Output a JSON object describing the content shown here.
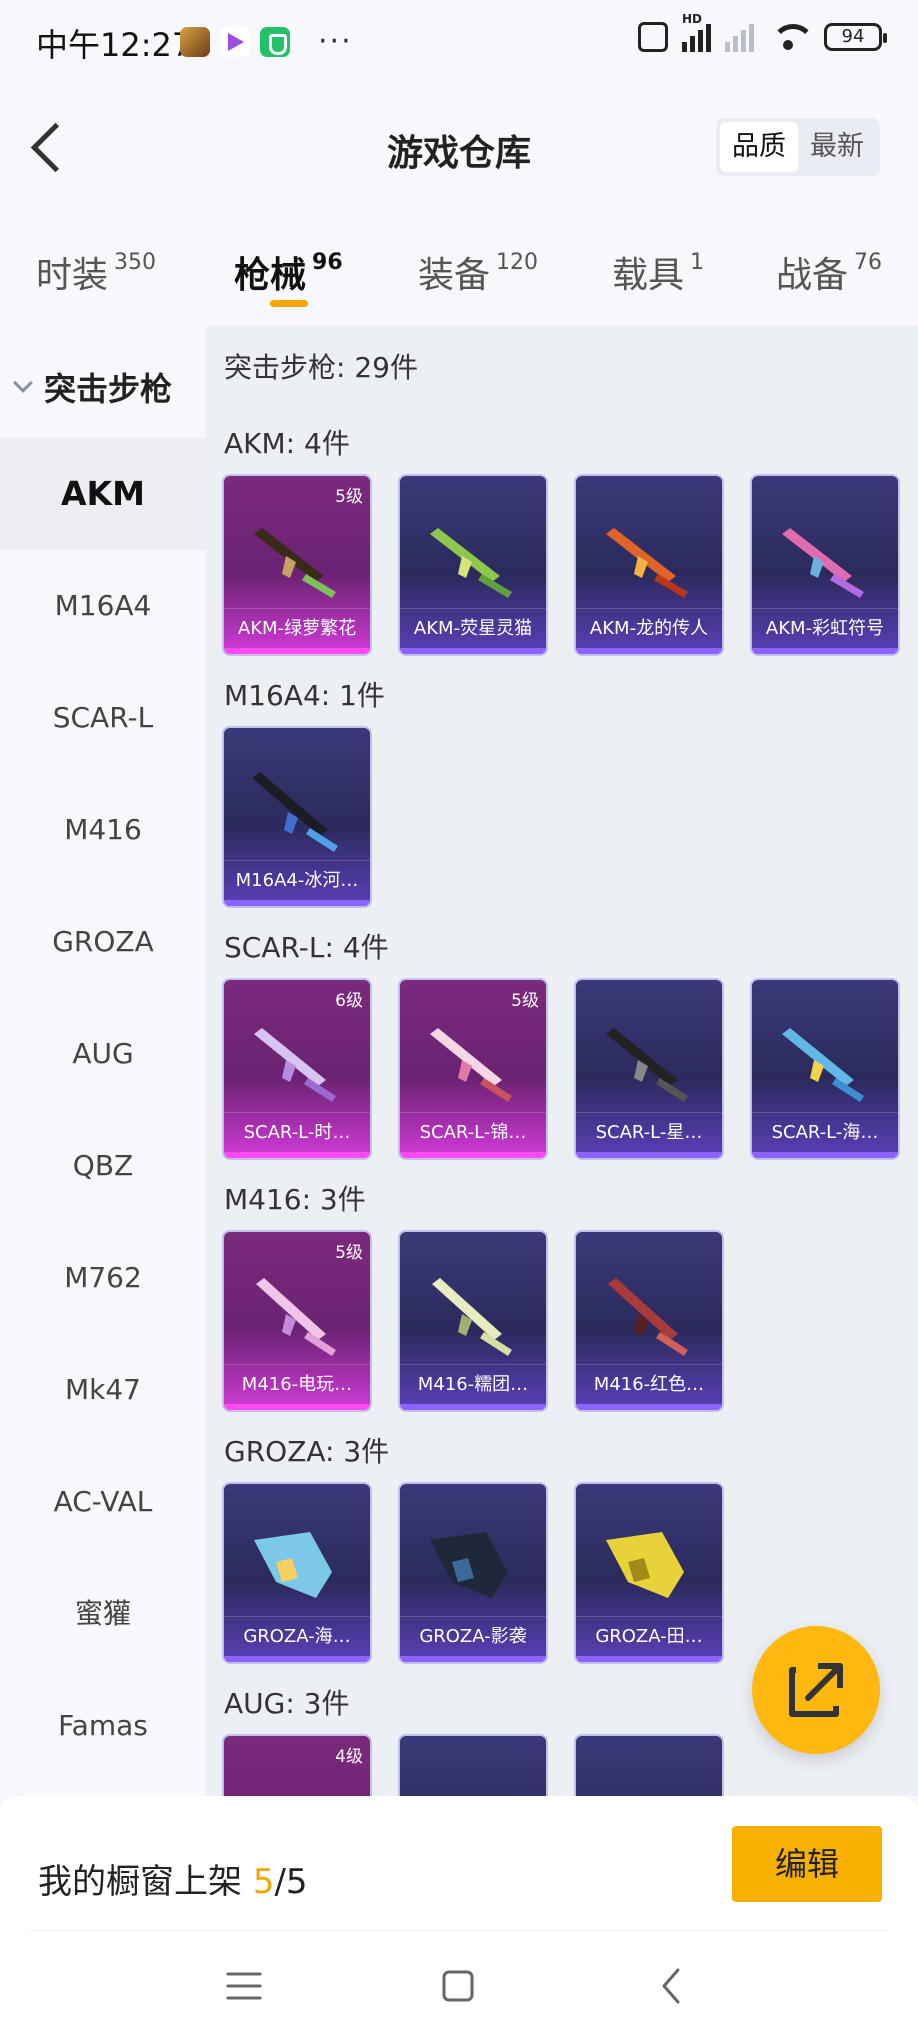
{
  "status_bar": {
    "time": "中午12:27",
    "more": "···",
    "hd_label": "HD",
    "battery": "94"
  },
  "header": {
    "title": "游戏仓库",
    "sort_options": [
      "品质",
      "最新"
    ],
    "sort_selected": "品质"
  },
  "tabs": [
    {
      "label": "时装",
      "count": "350"
    },
    {
      "label": "枪械",
      "count": "96",
      "active": true
    },
    {
      "label": "装备",
      "count": "120"
    },
    {
      "label": "载具",
      "count": "1"
    },
    {
      "label": "战备",
      "count": "76"
    }
  ],
  "sidebar": {
    "group": "突击步枪",
    "items": [
      "AKM",
      "M16A4",
      "SCAR-L",
      "M416",
      "GROZA",
      "AUG",
      "QBZ",
      "M762",
      "Mk47",
      "AC-VAL",
      "蜜獾",
      "Famas"
    ],
    "active": "AKM"
  },
  "content": {
    "summary": "突击步枪: 29件",
    "sections": [
      {
        "title": "AKM: 4件",
        "items": [
          {
            "name": "AKM-绿萝繁花",
            "level": "5级",
            "rarity": "purple"
          },
          {
            "name": "AKM-荧星灵猫",
            "level": "",
            "rarity": "blue"
          },
          {
            "name": "AKM-龙的传人",
            "level": "",
            "rarity": "blue"
          },
          {
            "name": "AKM-彩虹符号",
            "level": "",
            "rarity": "blue"
          }
        ]
      },
      {
        "title": "M16A4: 1件",
        "items": [
          {
            "name": "M16A4-冰河…",
            "level": "",
            "rarity": "blue"
          }
        ]
      },
      {
        "title": "SCAR-L: 4件",
        "items": [
          {
            "name": "SCAR-L-时…",
            "level": "6级",
            "rarity": "purple"
          },
          {
            "name": "SCAR-L-锦…",
            "level": "5级",
            "rarity": "purple"
          },
          {
            "name": "SCAR-L-星…",
            "level": "",
            "rarity": "blue"
          },
          {
            "name": "SCAR-L-海…",
            "level": "",
            "rarity": "blue"
          }
        ]
      },
      {
        "title": "M416: 3件",
        "items": [
          {
            "name": "M416-电玩…",
            "level": "5级",
            "rarity": "purple"
          },
          {
            "name": "M416-糯团…",
            "level": "",
            "rarity": "blue"
          },
          {
            "name": "M416-红色…",
            "level": "",
            "rarity": "blue"
          }
        ]
      },
      {
        "title": "GROZA: 3件",
        "items": [
          {
            "name": "GROZA-海…",
            "level": "",
            "rarity": "blue"
          },
          {
            "name": "GROZA-影袭",
            "level": "",
            "rarity": "blue"
          },
          {
            "name": "GROZA-田…",
            "level": "",
            "rarity": "blue"
          }
        ]
      },
      {
        "title": "AUG: 3件",
        "items": [
          {
            "name": "",
            "level": "4级",
            "rarity": "purple"
          },
          {
            "name": "",
            "level": "",
            "rarity": "blue"
          },
          {
            "name": "",
            "level": "",
            "rarity": "blue"
          }
        ]
      }
    ]
  },
  "bottom": {
    "showcase_label": "我的橱窗上架",
    "showcase_current": "5",
    "showcase_total": "/5",
    "edit_label": "编辑"
  },
  "colors": {
    "accent": "#f5a700",
    "card_blue": "#2b2a5c",
    "card_purple": "#6b2272"
  },
  "icons": {
    "back": "back-chevron-icon",
    "fab": "share-export-icon",
    "nav": [
      "menu-icon",
      "home-icon",
      "back-icon"
    ]
  }
}
